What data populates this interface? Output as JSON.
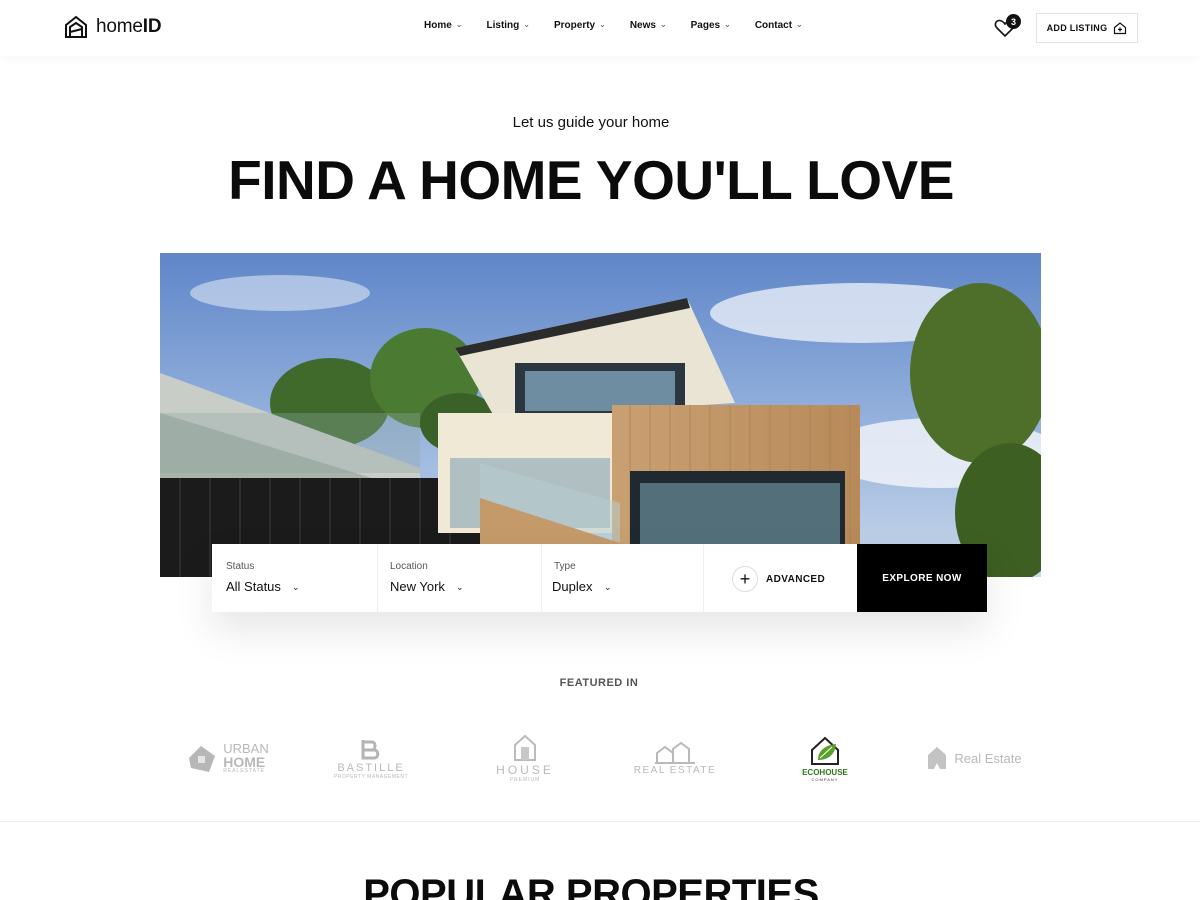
{
  "logo": {
    "text_light": "home",
    "text_bold": "ID",
    "icon": "house-logo-icon"
  },
  "nav": {
    "items": [
      {
        "label": "Home"
      },
      {
        "label": "Listing"
      },
      {
        "label": "Property"
      },
      {
        "label": "News"
      },
      {
        "label": "Pages"
      },
      {
        "label": "Contact"
      }
    ],
    "chevron": "⌄"
  },
  "header": {
    "wishlist_count": "3",
    "add_listing_label": "ADD LISTING"
  },
  "hero": {
    "subtitle": "Let us guide your home",
    "headline": "FIND A HOME YOU'LL LOVE"
  },
  "search": {
    "status": {
      "label": "Status",
      "value": "All Status"
    },
    "location": {
      "label": "Location",
      "value": "New York"
    },
    "type": {
      "label": "Type",
      "value": "Duplex"
    },
    "advanced_label": "ADVANCED",
    "explore_label": "EXPLORE NOW"
  },
  "featured": {
    "title": "FEATURED IN",
    "brands": [
      {
        "name": "URBAN",
        "sub": "HOME",
        "tag": "REALESTATE"
      },
      {
        "name": "BASTILLE",
        "tag": "PROPERTY MANAGEMENT"
      },
      {
        "name": "HOUSE",
        "tag": "PREMIUM"
      },
      {
        "name": "REAL ESTATE"
      },
      {
        "name": "ECOHOUSE",
        "tag": "COMPANY"
      },
      {
        "name": "Real Estate"
      }
    ]
  },
  "popular": {
    "title": "POPULAR PROPERTIES"
  },
  "colors": {
    "accent": "#000000",
    "eco_green": "#5aa02c"
  }
}
